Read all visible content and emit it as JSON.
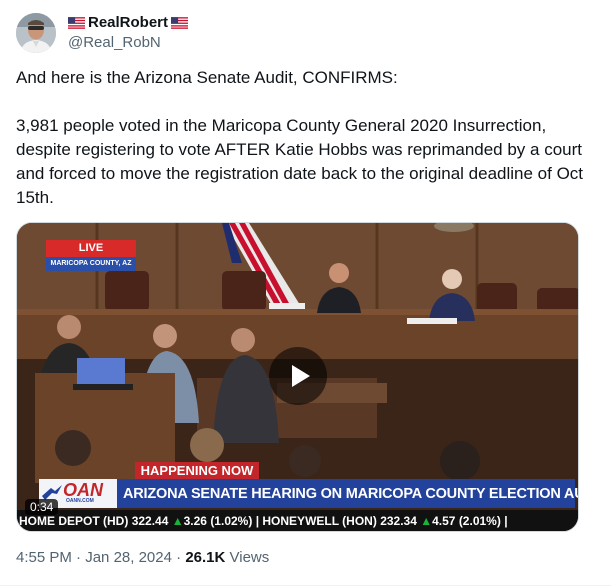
{
  "author": {
    "display_name": "RealRobert",
    "handle": "@Real_RobN",
    "avatar_icon": "user-avatar",
    "name_prefix_icon": "us-flag-icon",
    "name_suffix_icon": "us-flag-icon"
  },
  "tweet": {
    "text": "And here is the Arizona Senate Audit,  CONFIRMS:\n\n3,981 people voted in the Maricopa County General 2020 Insurrection, despite registering to vote AFTER Katie Hobbs was reprimanded by a court and forced to move the registration date back to the original deadline of Oct 15th."
  },
  "video": {
    "live_label": "LIVE",
    "live_location": "MARICOPA COUNTY, AZ",
    "happening_label": "HAPPENING NOW",
    "network_logo": "OAN",
    "network_url": "OANN.COM",
    "headline": "ARIZONA SENATE HEARING ON MARICOPA COUNTY ELECTION AUDIT",
    "ticker": {
      "lead": "HOME DEPOT (HD)",
      "lead_price": "322.44",
      "lead_change": "3.26 (1.02%)",
      "sep": "|",
      "second": "HONEYWELL (HON)",
      "second_price": "232.34",
      "second_change": "4.57 (2.01%)",
      "end": "|"
    },
    "duration": "0:34",
    "play_icon": "play-icon",
    "colors": {
      "live_red": "#d92a2a",
      "chyron_blue": "#23429c",
      "ticker_up": "#19b33a"
    }
  },
  "footer": {
    "time": "4:55 PM",
    "sep": "·",
    "date": "Jan 28, 2024",
    "views_count": "26.1K",
    "views_label": "Views"
  }
}
